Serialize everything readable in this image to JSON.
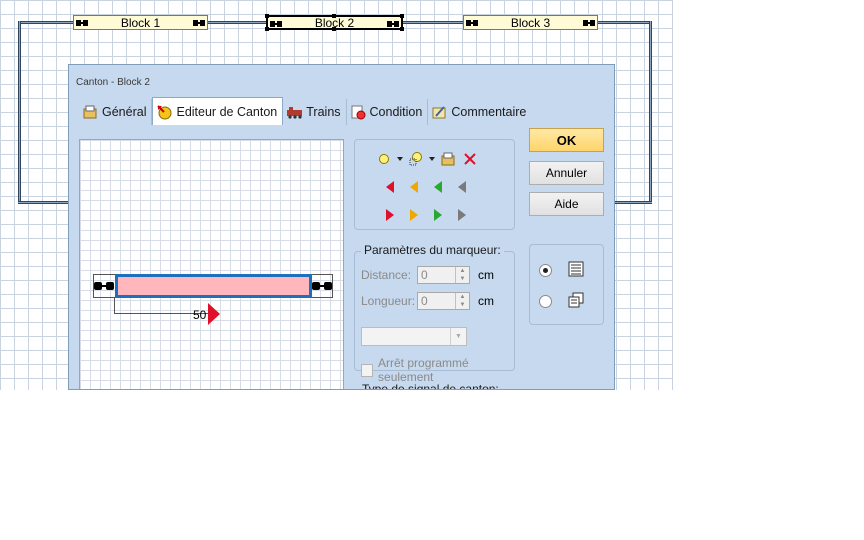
{
  "layout": {
    "blocks": [
      {
        "label": "Block 1",
        "selected": false
      },
      {
        "label": "Block 2",
        "selected": true
      },
      {
        "label": "Block 3",
        "selected": false
      }
    ]
  },
  "dialog": {
    "title": "Canton - Block 2",
    "tabs": [
      {
        "label": "Général",
        "icon": "general-icon",
        "active": false
      },
      {
        "label": "Editeur de Canton",
        "icon": "canton-editor-icon",
        "active": true
      },
      {
        "label": "Trains",
        "icon": "trains-icon",
        "active": false
      },
      {
        "label": "Condition",
        "icon": "condition-icon",
        "active": false
      },
      {
        "label": "Commentaire",
        "icon": "comment-icon",
        "active": false
      }
    ],
    "editor": {
      "marker_value": "50"
    },
    "marker_params": {
      "legend": "Paramètres du marqueur:",
      "distance_label": "Distance:",
      "distance_value": "0",
      "distance_unit": "cm",
      "length_label": "Longueur:",
      "length_value": "0",
      "length_unit": "cm",
      "combo_value": "",
      "scheduled_stop_label": "Arrêt programmé seulement"
    },
    "signal_type_legend": "Type de signal de canton:",
    "buttons": {
      "ok": "OK",
      "cancel": "Annuler",
      "help": "Aide"
    },
    "view_mode": {
      "selected": "list"
    }
  },
  "colors": {
    "accent_red": "#e0102a",
    "accent_orange": "#f0a800",
    "accent_green": "#2aa830",
    "accent_gray": "#7a7a7a",
    "canton_fill": "#ffb7bd",
    "canton_border": "#1f6fbf",
    "dialog_bg": "#c6d9ee"
  }
}
